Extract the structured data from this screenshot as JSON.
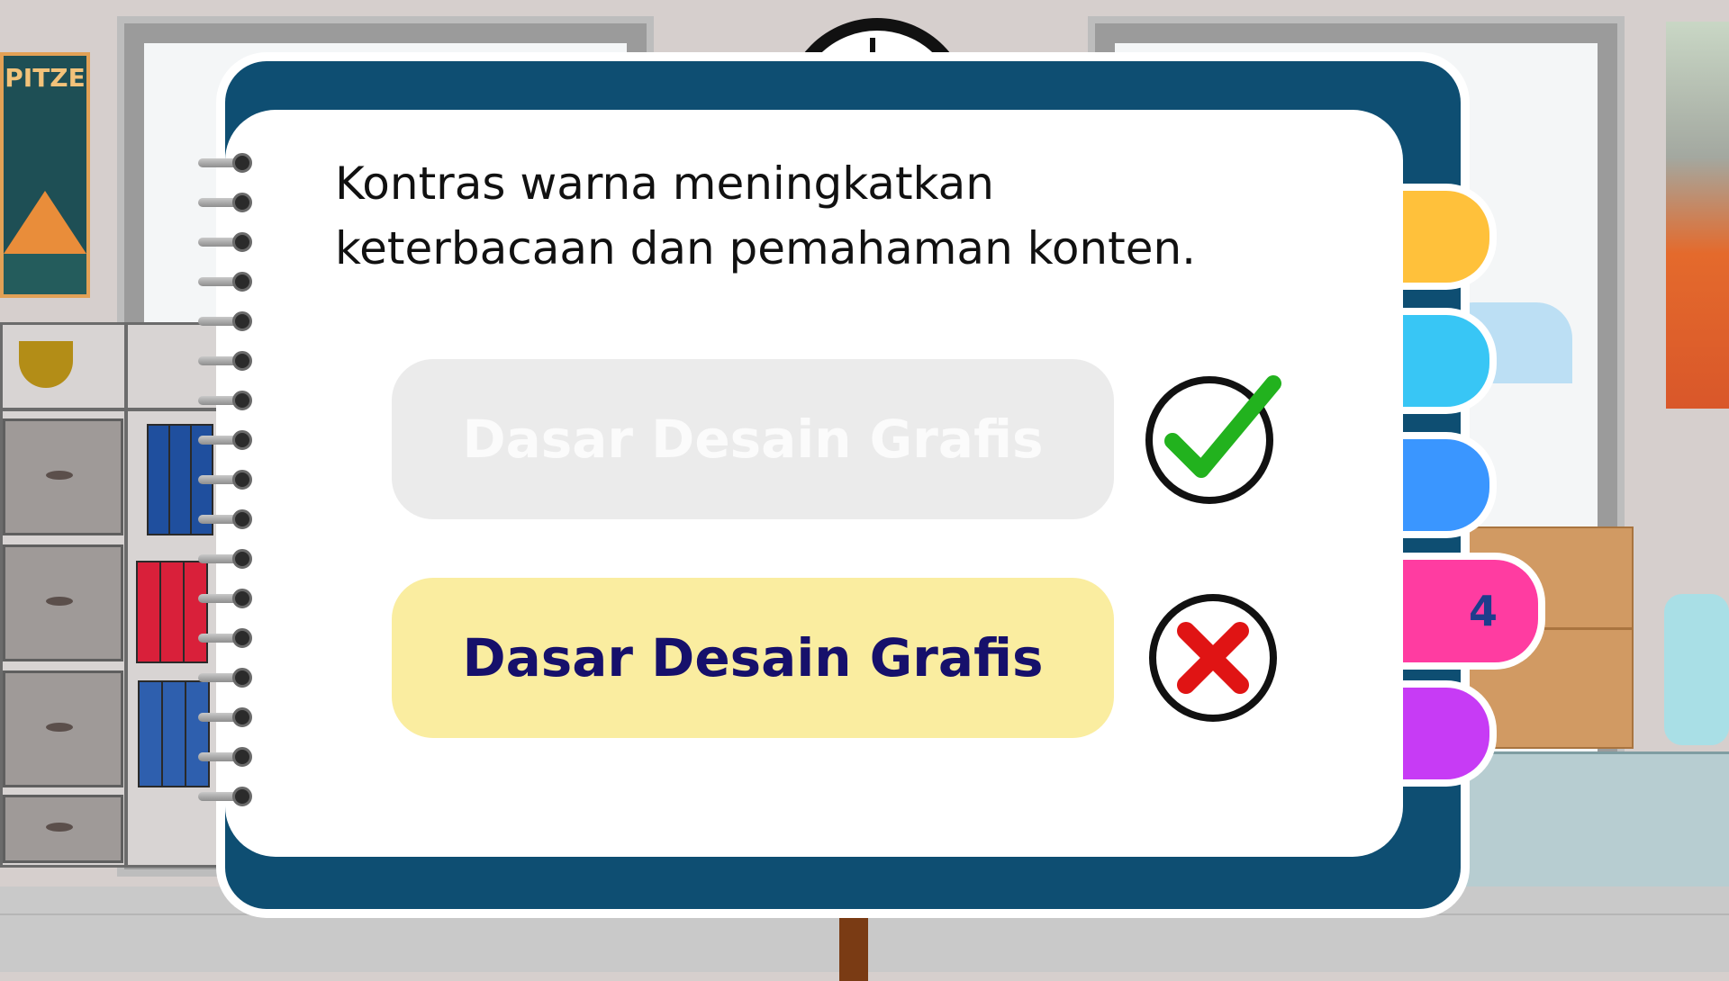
{
  "question": {
    "line1": "Kontras warna meningkatkan",
    "line2": "keterbacaan dan pemahaman konten."
  },
  "options": [
    {
      "label": "Dasar Desain Grafis",
      "mark": "check-icon",
      "state": "dimmed"
    },
    {
      "label": "Dasar Desain Grafis",
      "mark": "cross-icon",
      "state": "highlighted"
    }
  ],
  "tabs": [
    {
      "label": "",
      "color": "#ffc13b"
    },
    {
      "label": "",
      "color": "#38c6f5"
    },
    {
      "label": "",
      "color": "#3a96ff"
    },
    {
      "label": "4",
      "color": "#ff3ca1"
    },
    {
      "label": "",
      "color": "#c73bf5"
    }
  ],
  "background_poster_text": "PITZE",
  "colors": {
    "board": "#0e4e72",
    "check": "#22b21e",
    "cross": "#e01414",
    "option_highlight": "#faeda0",
    "option_text": "#16106b"
  }
}
